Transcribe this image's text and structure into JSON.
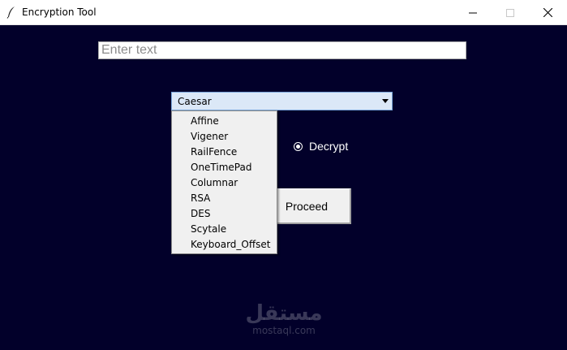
{
  "window": {
    "title": "Encryption Tool",
    "icon": "feather-icon",
    "controls": {
      "minimize": "minimize-icon",
      "maximize": "maximize-icon",
      "close": "close-icon"
    }
  },
  "input": {
    "value": "",
    "placeholder": "Enter text"
  },
  "combo": {
    "selected": "Caesar",
    "options": [
      "Affine",
      "Vigener",
      "RailFence",
      "OneTimePad",
      "Columnar",
      "RSA",
      "DES",
      "Scytale",
      "Keyboard_Offset"
    ]
  },
  "radio": {
    "label": "Decrypt",
    "selected": true
  },
  "button": {
    "label": "Proceed"
  },
  "watermark": {
    "logo": "مستقل",
    "site": "mostaql.com"
  },
  "colors": {
    "background": "#02002a",
    "combo_bg": "#dbe8f7",
    "menu_bg": "#f0f0f0"
  }
}
